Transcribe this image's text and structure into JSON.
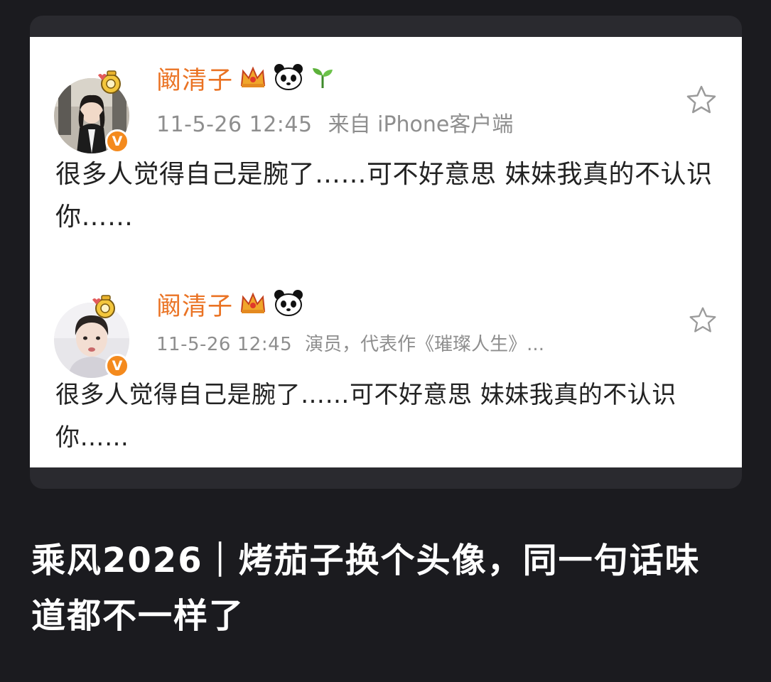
{
  "posts": [
    {
      "username": "阚清子",
      "badges": [
        "crown-badge-icon",
        "panda-badge-icon",
        "sprout-badge-icon"
      ],
      "time": "11-5-26 12:45",
      "source": "来自 iPhone客户端",
      "content": "很多人觉得自己是腕了……可不好意思 妹妹我真的不认识你……",
      "verified_mark": "V"
    },
    {
      "username": "阚清子",
      "badges": [
        "crown-badge-icon",
        "panda-badge-icon"
      ],
      "time": "11-5-26 12:45",
      "source": "演员，代表作《璀璨人生》...",
      "content": "很多人觉得自己是腕了……可不好意思 妹妹我真的不认识你……",
      "verified_mark": "V"
    }
  ],
  "headline": "乘风2026｜烤茄子换个头像，同一句话味道都不一样了",
  "colors": {
    "background": "#1b1b1f",
    "card": "#ffffff",
    "username": "#ea7324",
    "meta": "#8e8e8e",
    "verified": "#f48a1d"
  }
}
